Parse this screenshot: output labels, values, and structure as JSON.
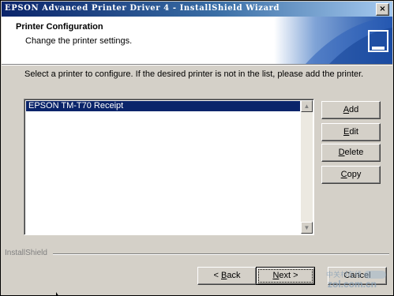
{
  "window": {
    "title": "EPSON Advanced Printer Driver 4 - InstallShield Wizard",
    "close_glyph": "×"
  },
  "header": {
    "title": "Printer Configuration",
    "subtitle": "Change the printer settings."
  },
  "instruction": "Select a printer to configure. If the desired printer is not in the list, please add the printer.",
  "printer_list": {
    "items": [
      "EPSON TM-T70 Receipt"
    ],
    "selected_index": 0
  },
  "side_buttons": {
    "add": {
      "before": "",
      "mnemonic": "A",
      "after": "dd"
    },
    "edit": {
      "before": "",
      "mnemonic": "E",
      "after": "dit"
    },
    "delete": {
      "before": "",
      "mnemonic": "D",
      "after": "elete"
    },
    "copy": {
      "before": "",
      "mnemonic": "C",
      "after": "opy"
    }
  },
  "footer": {
    "brand": "InstallShield",
    "back": {
      "before": "< ",
      "mnemonic": "B",
      "after": "ack"
    },
    "next": {
      "before": "",
      "mnemonic": "N",
      "after": "ext >"
    },
    "cancel": "Cancel"
  },
  "watermark": {
    "top": "中关村在线",
    "bottom": "zol.com.cn"
  },
  "icons": {
    "scroll_up": "▲",
    "scroll_down": "▼",
    "banner": "installshield-banner-graphic"
  },
  "colors": {
    "title_bar": "#0a246a",
    "selection": "#0a246a",
    "dialog_face": "#d4d0c8"
  }
}
